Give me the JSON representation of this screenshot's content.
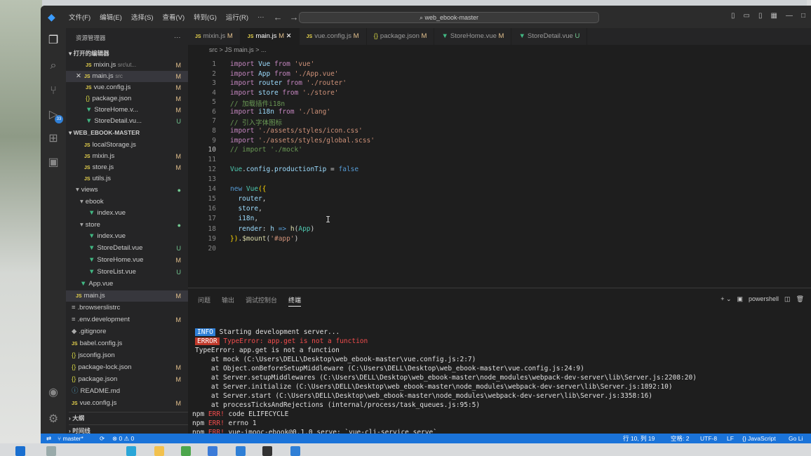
{
  "titlebar": {
    "menu": [
      "文件(F)",
      "编辑(E)",
      "选择(S)",
      "查看(V)",
      "转到(G)",
      "运行(R)",
      "···"
    ],
    "search_text": "web_ebook-master"
  },
  "activity": {
    "source_control_badge": "33"
  },
  "sidebar": {
    "title": "资源管理器",
    "open_editors_label": "打开的编辑器",
    "open_editors": [
      {
        "name": "mixin.js",
        "detail": "src\\ut...",
        "status": "M"
      },
      {
        "name": "main.js",
        "detail": "src",
        "status": "M"
      },
      {
        "name": "vue.config.js",
        "detail": "",
        "status": "M"
      },
      {
        "name": "package.json",
        "detail": "",
        "status": "M"
      },
      {
        "name": "StoreHome.v...",
        "detail": "",
        "status": "M"
      },
      {
        "name": "StoreDetail.vu...",
        "detail": "",
        "status": "U"
      }
    ],
    "project_label": "WEB_EBOOK-MASTER",
    "tree": [
      {
        "name": "localStorage.js",
        "status": ""
      },
      {
        "name": "mixin.js",
        "status": "M"
      },
      {
        "name": "store.js",
        "status": "M"
      },
      {
        "name": "utils.js",
        "status": ""
      },
      {
        "name": "views",
        "status": "●"
      },
      {
        "name": "ebook",
        "status": ""
      },
      {
        "name": "index.vue",
        "status": ""
      },
      {
        "name": "store",
        "status": "●"
      },
      {
        "name": "index.vue",
        "status": ""
      },
      {
        "name": "StoreDetail.vue",
        "status": "U"
      },
      {
        "name": "StoreHome.vue",
        "status": "M"
      },
      {
        "name": "StoreList.vue",
        "status": "U"
      },
      {
        "name": "App.vue",
        "status": ""
      },
      {
        "name": "main.js",
        "status": "M"
      },
      {
        "name": ".browserslistrc",
        "status": ""
      },
      {
        "name": ".env.development",
        "status": "M"
      },
      {
        "name": ".gitignore",
        "status": ""
      },
      {
        "name": "babel.config.js",
        "status": ""
      },
      {
        "name": "jsconfig.json",
        "status": ""
      },
      {
        "name": "package-lock.json",
        "status": "M"
      },
      {
        "name": "package.json",
        "status": "M"
      },
      {
        "name": "README.md",
        "status": ""
      },
      {
        "name": "vue.config.js",
        "status": "M"
      }
    ],
    "outline_label": "大纲",
    "timeline_label": "时间线"
  },
  "tabs": [
    {
      "name": "mixin.js",
      "status": "M"
    },
    {
      "name": "main.js",
      "status": "M"
    },
    {
      "name": "vue.config.js",
      "status": "M"
    },
    {
      "name": "package.json",
      "status": "M"
    },
    {
      "name": "StoreHome.vue",
      "status": "M"
    },
    {
      "name": "StoreDetail.vue",
      "status": "U"
    }
  ],
  "breadcrumb": "src  >  JS main.js  >  ...",
  "editor": {
    "line_numbers": [
      "1",
      "2",
      "3",
      "4",
      "5",
      "6",
      "7",
      "8",
      "9",
      "10",
      "11",
      "12",
      "13",
      "14",
      "15",
      "16",
      "17",
      "18",
      "19",
      "20"
    ]
  },
  "panel": {
    "tabs": [
      "问题",
      "输出",
      "调试控制台",
      "终端"
    ],
    "shell": "powershell",
    "info_tag": "INFO",
    "error_tag": "ERROR",
    "lines": [
      "Starting development server...",
      "TypeError: app.get is not a function",
      "TypeError: app.get is not a function",
      "    at mock (C:\\Users\\DELL\\Desktop\\web_ebook-master\\vue.config.js:2:7)",
      "    at Object.onBeforeSetupMiddleware (C:\\Users\\DELL\\Desktop\\web_ebook-master\\vue.config.js:24:9)",
      "    at Server.setupMiddlewares (C:\\Users\\DELL\\Desktop\\web_ebook-master\\node_modules\\webpack-dev-server\\lib\\Server.js:2208:20)",
      "    at Server.initialize (C:\\Users\\DELL\\Desktop\\web_ebook-master\\node_modules\\webpack-dev-server\\lib\\Server.js:1892:10)",
      "    at Server.start (C:\\Users\\DELL\\Desktop\\web_ebook-master\\node_modules\\webpack-dev-server\\lib\\Server.js:3358:16)",
      "    at processTicksAndRejections (internal/process/task_queues.js:95:5)"
    ],
    "npm_prefix": "npm",
    "npm_err": "ERR!",
    "npm_lines": [
      " code ELIFECYCLE",
      " errno 1",
      " vue-imooc-ebook@0.1.0 serve: `vue-cli-service serve`"
    ]
  },
  "statusbar": {
    "branch": "master*",
    "problems": "⊗ 0 ⚠ 0",
    "position": "行 10, 列 19",
    "spaces": "空格: 2",
    "encoding": "UTF-8",
    "eol": "LF",
    "language": "{} JavaScript",
    "golive": "Go Li"
  }
}
